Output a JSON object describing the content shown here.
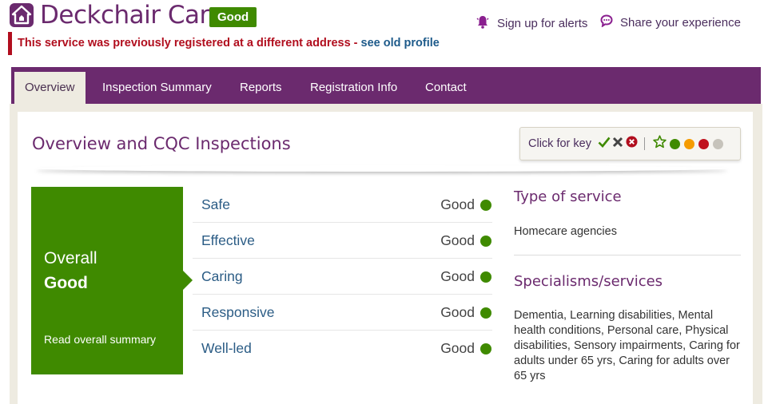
{
  "header": {
    "provider_name": "Deckchair Care",
    "rating_badge": "Good",
    "alerts_link": "Sign up for alerts",
    "share_link": "Share your experience"
  },
  "notice": {
    "text": "This service was previously registered at a different address - ",
    "link": "see old profile"
  },
  "nav": {
    "tabs": [
      {
        "label": "Overview",
        "active": true
      },
      {
        "label": "Inspection Summary",
        "active": false
      },
      {
        "label": "Reports",
        "active": false
      },
      {
        "label": "Registration Info",
        "active": false
      },
      {
        "label": "Contact",
        "active": false
      }
    ]
  },
  "section": {
    "title": "Overview and CQC Inspections"
  },
  "key": {
    "label": "Click for key",
    "icons": [
      "tick-icon",
      "cross-icon",
      "cross-circle-icon",
      "star-outline-icon"
    ],
    "dots": [
      "#3f8a00",
      "#f59b00",
      "#c0121e",
      "#c6c3bb"
    ]
  },
  "overall": {
    "label": "Overall",
    "rating": "Good",
    "summary_link": "Read overall summary"
  },
  "domains": [
    {
      "name": "Safe",
      "rating": "Good"
    },
    {
      "name": "Effective",
      "rating": "Good"
    },
    {
      "name": "Caring",
      "rating": "Good"
    },
    {
      "name": "Responsive",
      "rating": "Good"
    },
    {
      "name": "Well-led",
      "rating": "Good"
    }
  ],
  "sidebar": {
    "type_heading": "Type of service",
    "type_value": "Homecare agencies",
    "specialisms_heading": "Specialisms/services",
    "specialisms_value": "Dementia, Learning disabilities, Mental health conditions, Personal care, Physical disabilities, Sensory impairments, Caring for adults under 65 yrs, Caring for adults over 65 yrs"
  },
  "colors": {
    "brand_purple": "#6b2a6e",
    "rating_good": "#3f8a00",
    "alert_red": "#b10e1e",
    "link_blue": "#2b5c85",
    "panel_beige": "#eeebe1"
  }
}
